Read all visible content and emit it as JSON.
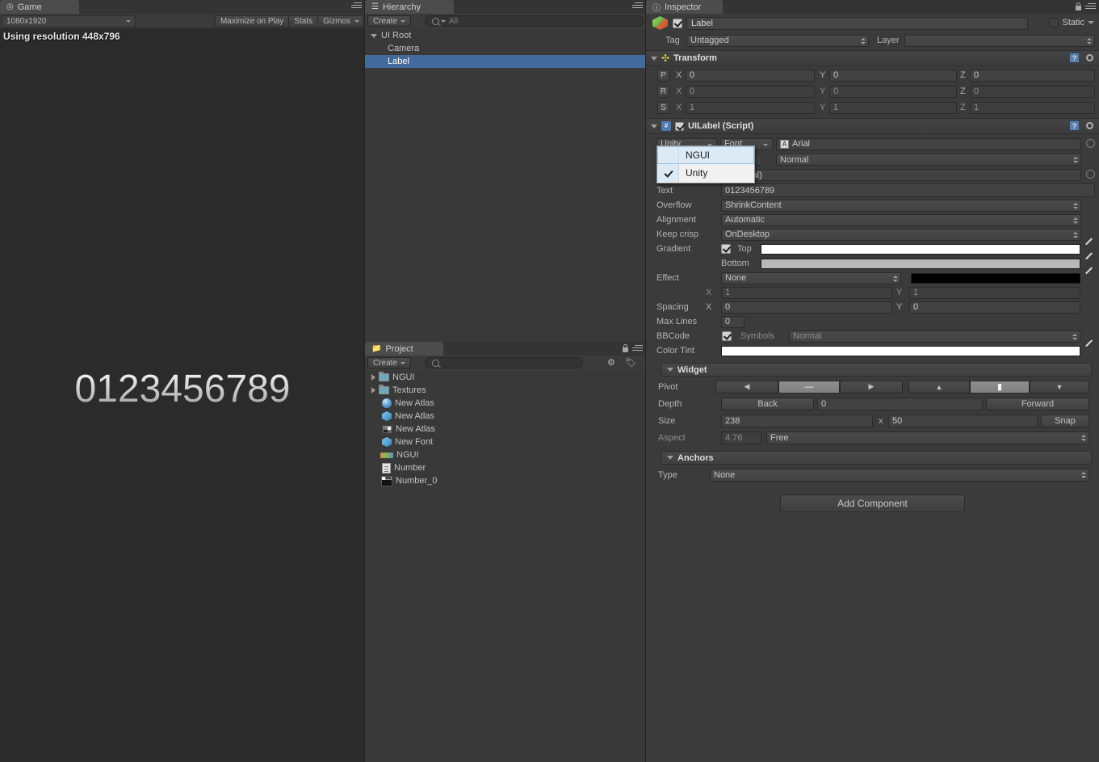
{
  "game": {
    "tab_label": "Game",
    "tab_icon": "game-controller-icon",
    "resolution_dropdown": "1080x1920",
    "maximize_on_play": "Maximize on Play",
    "stats": "Stats",
    "gizmos": "Gizmos",
    "resolution_notice": "Using resolution 448x796",
    "rendered_label_text": "0123456789"
  },
  "hierarchy": {
    "tab_label": "Hierarchy",
    "tab_icon": "hierarchy-icon",
    "create_label": "Create",
    "search_placeholder": "All",
    "items": [
      {
        "label": "UI Root",
        "indent": 0,
        "expanded": true,
        "selected": false
      },
      {
        "label": "Camera",
        "indent": 1,
        "expanded": false,
        "selected": false
      },
      {
        "label": "Label",
        "indent": 1,
        "expanded": false,
        "selected": true
      }
    ]
  },
  "project": {
    "tab_label": "Project",
    "tab_icon": "folder-icon",
    "create_label": "Create",
    "search_placeholder": "",
    "items": [
      {
        "label": "NGUI",
        "icon": "folder-icon",
        "arrow": true
      },
      {
        "label": "Textures",
        "icon": "folder-icon",
        "arrow": true
      },
      {
        "label": "New Atlas",
        "icon": "sphere-icon",
        "arrow": false
      },
      {
        "label": "New Atlas",
        "icon": "prefab-icon",
        "arrow": false
      },
      {
        "label": "New Atlas",
        "icon": "texture-icon",
        "arrow": false
      },
      {
        "label": "New Font",
        "icon": "prefab-icon",
        "arrow": false
      },
      {
        "label": "NGUI",
        "icon": "ngui-icon",
        "arrow": false
      },
      {
        "label": "Number",
        "icon": "document-icon",
        "arrow": false
      },
      {
        "label": "Number_0",
        "icon": "fonttex-icon",
        "arrow": false
      }
    ]
  },
  "inspector": {
    "tab_label": "Inspector",
    "tab_icon": "info-icon",
    "object_name": "Label",
    "object_enabled": true,
    "static_label": "Static",
    "static_checked": false,
    "tag_label": "Tag",
    "tag_value": "Untagged",
    "layer_label": "Layer",
    "layer_value": "",
    "transform": {
      "title": "Transform",
      "rows": [
        {
          "badge": "P",
          "x": "0",
          "y": "0",
          "z": "0",
          "dim": false
        },
        {
          "badge": "R",
          "x": "0",
          "y": "0",
          "z": "0",
          "dim": true
        },
        {
          "badge": "S",
          "x": "1",
          "y": "1",
          "z": "1",
          "dim": true
        }
      ],
      "axis_x": "X",
      "axis_y": "Y",
      "axis_z": "Z"
    },
    "uilabel": {
      "title": "UILabel (Script)",
      "enabled": true,
      "font_source": "Unity",
      "font_kind": "Font",
      "font_asset": "Arial",
      "font_style": "Normal",
      "material_value": "Material)",
      "text_label": "Text",
      "text_value": "0123456789",
      "overflow_label": "Overflow",
      "overflow_value": "ShrinkContent",
      "alignment_label": "Alignment",
      "alignment_value": "Automatic",
      "keepcrisp_label": "Keep crisp",
      "keepcrisp_value": "OnDesktop",
      "gradient_label": "Gradient",
      "gradient_checked": true,
      "gradient_top_label": "Top",
      "gradient_bottom_label": "Bottom",
      "gradient_top_color": "#ffffff",
      "gradient_bottom_color": "#b8b8b8",
      "effect_label": "Effect",
      "effect_value": "None",
      "effect_color": "#000000",
      "effect_x_axis": "X",
      "effect_x_value": "1",
      "effect_y_axis": "Y",
      "effect_y_value": "1",
      "spacing_label": "Spacing",
      "spacing_x_axis": "X",
      "spacing_x_value": "0",
      "spacing_y_axis": "Y",
      "spacing_y_value": "0",
      "maxlines_label": "Max Lines",
      "maxlines_value": "0",
      "bbcode_label": "BBCode",
      "bbcode_checked": true,
      "symbols_label": "Symbols",
      "symbols_value": "Normal",
      "colortint_label": "Color Tint",
      "colortint_color": "#ffffff"
    },
    "widget": {
      "title": "Widget",
      "pivot_label": "Pivot",
      "pivot_left": "◀",
      "pivot_hcenter": "—",
      "pivot_right": "▶",
      "pivot_top": "▲",
      "pivot_vcenter": "▮",
      "pivot_bottom": "▼",
      "depth_label": "Depth",
      "depth_back": "Back",
      "depth_value": "0",
      "depth_forward": "Forward",
      "size_label": "Size",
      "size_w": "238",
      "size_x_sep": "x",
      "size_h": "50",
      "snap_label": "Snap",
      "aspect_label": "Aspect",
      "aspect_value": "4.76",
      "aspect_mode": "Free"
    },
    "anchors": {
      "title": "Anchors",
      "type_label": "Type",
      "type_value": "None"
    },
    "add_component": "Add Component"
  },
  "font_dropdown": {
    "items": [
      {
        "label": "NGUI",
        "checked": false,
        "highlighted": true
      },
      {
        "label": "Unity",
        "checked": true,
        "highlighted": false
      }
    ]
  },
  "colors": {
    "selection_blue": "#44699b",
    "panel_bg": "#3b3b3b",
    "list_bg": "#393939",
    "popup_bg": "#f1f1f1",
    "popup_highlight": "#dceaf5"
  }
}
